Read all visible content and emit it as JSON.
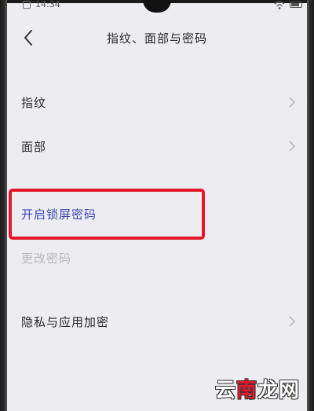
{
  "status_bar": {
    "time": "14:34"
  },
  "header": {
    "back_icon": "chevron-left-icon",
    "title": "指纹、面部与密码"
  },
  "settings": {
    "items": [
      {
        "label": "指纹",
        "chevron": true,
        "style": "normal"
      },
      {
        "label": "面部",
        "chevron": true,
        "style": "normal"
      },
      {
        "label": "开启锁屏密码",
        "chevron": false,
        "style": "accent"
      },
      {
        "label": "更改密码",
        "chevron": false,
        "style": "disabled"
      },
      {
        "label": "隐私与应用加密",
        "chevron": true,
        "style": "normal"
      }
    ]
  },
  "watermark": {
    "part1": "云",
    "part2": "南",
    "part3": "龙网"
  },
  "colors": {
    "background": "#ececf1",
    "accent_text": "#3c4ab8",
    "disabled_text": "#b6b6be",
    "highlight": "#e3182b"
  }
}
